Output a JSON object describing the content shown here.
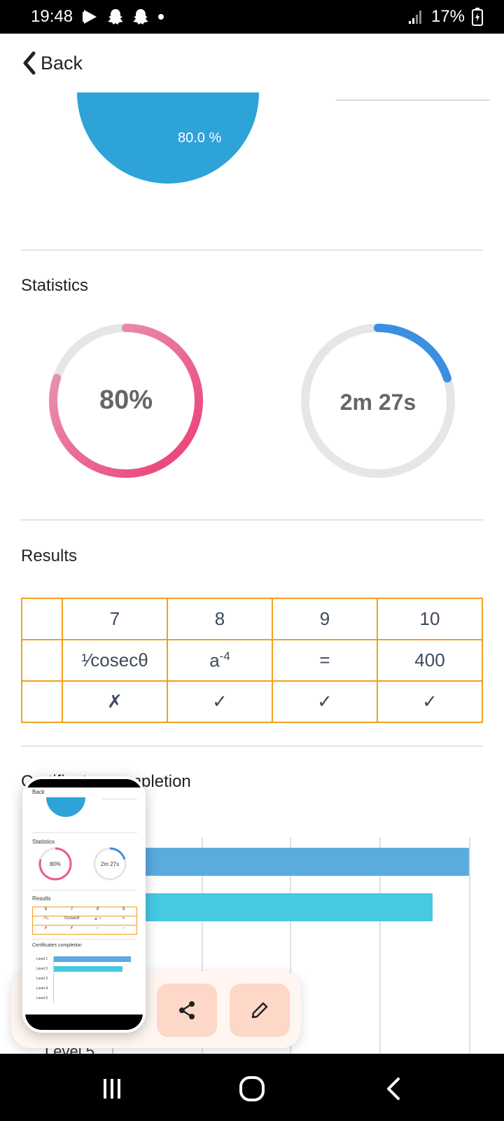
{
  "status_bar": {
    "time": "19:48",
    "battery": "17%"
  },
  "header": {
    "back_label": "Back"
  },
  "pie": {
    "label": "80.0 %",
    "color": "#2ea3d8"
  },
  "statistics": {
    "title": "Statistics",
    "score": {
      "text": "80%",
      "value": 0.8,
      "track_color": "#e6e6e6",
      "start_color": "#ec3a72",
      "end_color": "#e8a3b8"
    },
    "time": {
      "text": "2m 27s",
      "value": 0.2,
      "track_color": "#e6e6e6",
      "color": "#3b8fe0"
    }
  },
  "results": {
    "title": "Results",
    "columns": [
      "7",
      "8",
      "9",
      "10"
    ],
    "answers": [
      "¹⁄cosecθ",
      "a",
      "=",
      "400"
    ],
    "answer_8_exponent": "-4",
    "marks": [
      "✗",
      "✓",
      "✓",
      "✓"
    ]
  },
  "certificates": {
    "title": "Certificates completion",
    "visible_label": "Level 5",
    "bar_colors": [
      "#5aabde",
      "#47c8e3"
    ]
  },
  "thumbnail": {
    "back": "Back",
    "pie_label": "80.0 %",
    "stats_title": "Statistics",
    "score": "80%",
    "time": "2m 27s",
    "results_title": "Results",
    "row1": [
      "6",
      "7",
      "8",
      "9"
    ],
    "row2": [
      "-²/₃",
      "¹⁄cosecθ",
      "a⁻⁴",
      "="
    ],
    "row3": [
      "✗",
      "✗",
      "✓",
      "✓"
    ],
    "cert_title": "Certificates completion",
    "levels": [
      "Level 1",
      "Level 2",
      "Level 3",
      "Level 4",
      "Level 5"
    ]
  },
  "actions": {
    "share": "share-icon",
    "edit": "pencil-icon"
  }
}
